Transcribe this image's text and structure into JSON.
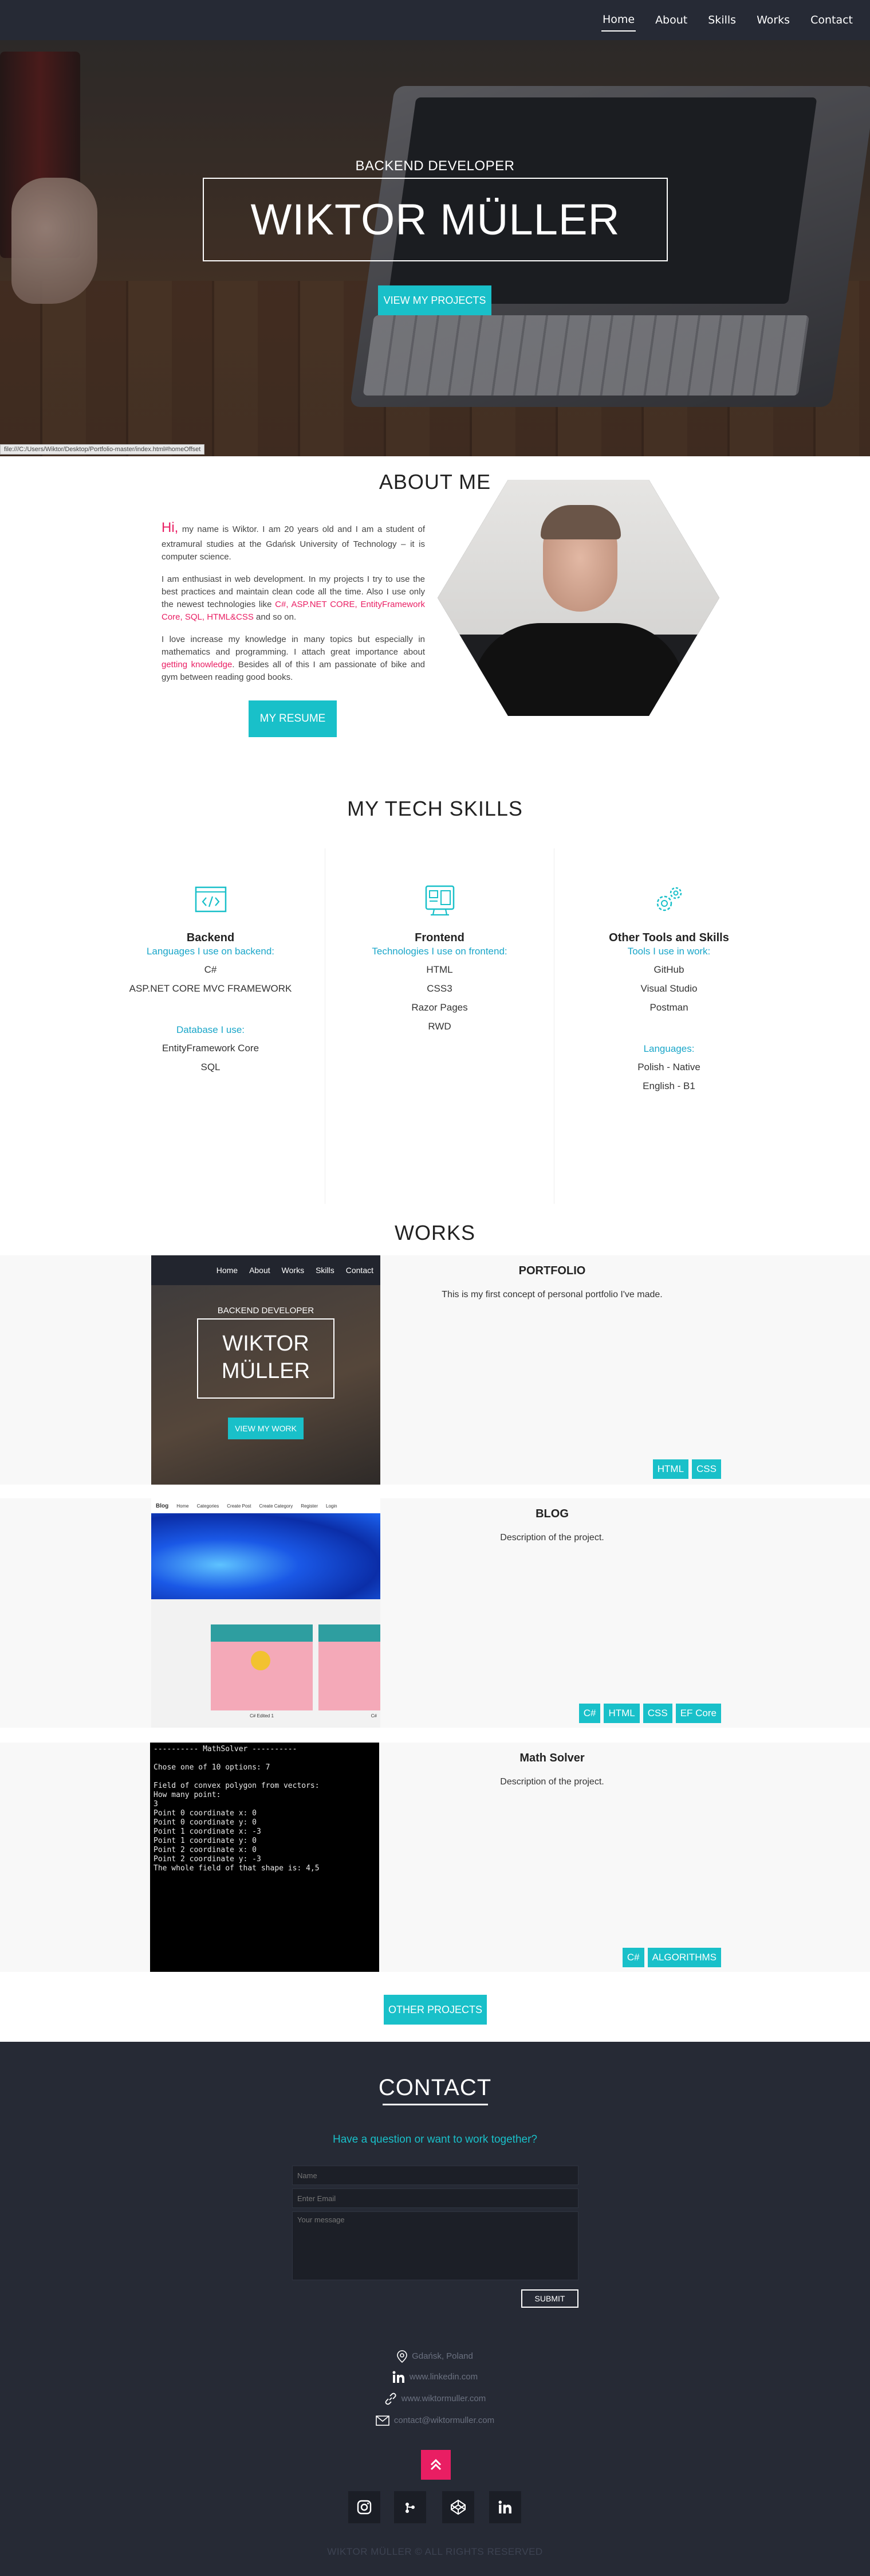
{
  "nav": {
    "items": [
      {
        "label": "Home"
      },
      {
        "label": "About"
      },
      {
        "label": "Skills"
      },
      {
        "label": "Works"
      },
      {
        "label": "Contact"
      }
    ]
  },
  "hero": {
    "subtitle": "BACKEND DEVELOPER",
    "title": "WIKTOR MÜLLER",
    "button": "VIEW MY PROJECTS",
    "status_url": "file:///C:/Users/Wiktor/Desktop/Portfolio-master/index.html#homeOffset"
  },
  "about": {
    "title": "ABOUT ME",
    "hi": "Hi,",
    "p1_rest": " my name is Wiktor. I am 20 years old and I am a student of extramural studies at the Gdańsk University of Technology – it is computer science.",
    "p2_start": "I am enthusiast in web development. In my projects I try to use the best practices and maintain clean code all the time. Also I use only the newest technologies like ",
    "p2_tech": "C#, ASP.NET CORE, EntityFramework Core, SQL, HTML&CSS",
    "p2_end": " and so on.",
    "p3_start": "I love increase my knowledge in many topics but especially in mathematics and programming. I attach great importance about ",
    "p3_hl": "getting knowledge",
    "p3_end": ". Besides all of this I am passionate of bike and gym between reading good books.",
    "resume": "MY RESUME"
  },
  "skills": {
    "title": "MY TECH SKILLS",
    "backend": {
      "head": "Backend",
      "sub": "Languages I use on backend:",
      "items": [
        "C#",
        "ASP.NET CORE MVC FRAMEWORK"
      ],
      "sub2": "Database I use:",
      "items2": [
        "EntityFramework Core",
        "SQL"
      ]
    },
    "frontend": {
      "head": "Frontend",
      "sub": "Technologies I use on frontend:",
      "items": [
        "HTML",
        "CSS3",
        "Razor Pages",
        "RWD"
      ]
    },
    "other": {
      "head": "Other Tools and Skills",
      "sub": "Tools I use in work:",
      "items": [
        "GitHub",
        "Visual Studio",
        "Postman"
      ],
      "sub2": "Languages:",
      "items2": [
        "Polish - Native",
        "English - B1"
      ]
    }
  },
  "works": {
    "title": "WORKS",
    "items": [
      {
        "title": "PORTFOLIO",
        "desc": "This is my first concept of personal portfolio I've made.",
        "tags": [
          "HTML",
          "CSS"
        ],
        "preview": {
          "nav": [
            "Home",
            "About",
            "Works",
            "Skills",
            "Contact"
          ],
          "subtitle": "BACKEND DEVELOPER",
          "title1": "WIKTOR",
          "title2": "MÜLLER",
          "button": "VIEW MY WORK"
        }
      },
      {
        "title": "BLOG",
        "desc": "Description of the project.",
        "tags": [
          "C#",
          "HTML",
          "CSS",
          "EF Core"
        ],
        "preview": {
          "brand": "Blog",
          "nav": [
            "Home",
            "Categories",
            "Create Post",
            "Create Category",
            "Register",
            "Login"
          ],
          "caption1": "C# Edited 1",
          "caption2": "C#"
        }
      },
      {
        "title": "Math Solver",
        "desc": "Description of the project.",
        "tags": [
          "C#",
          "ALGORITHMS"
        ],
        "terminal": "---------- MathSolver ----------\n\nChose one of 10 options: 7\n\nField of convex polygon from vectors:\nHow many point:\n3\nPoint 0 coordinate x: 0\nPoint 0 coordinate y: 0\nPoint 1 coordinate x: -3\nPoint 1 coordinate y: 0\nPoint 2 coordinate x: 0\nPoint 2 coordinate y: -3\nThe whole field of that shape is: 4,5"
      }
    ],
    "other_button": "OTHER PROJECTS"
  },
  "contact": {
    "title": "CONTACT",
    "subtitle": "Have a question or want to work together?",
    "name_placeholder": "Name",
    "email_placeholder": "Enter Email",
    "message_placeholder": "Your message",
    "submit": "SUBMIT",
    "location": "Gdańsk, Poland",
    "linkedin": "www.linkedin.com",
    "website": "www.wiktormuller.com",
    "email": "contact@wiktormuller.com",
    "footer": "WIKTOR MÜLLER © ALL RIGHTS RESERVED"
  },
  "colors": {
    "accent": "#19c0c9",
    "highlight": "#e91e63",
    "dark": "#262a35"
  }
}
